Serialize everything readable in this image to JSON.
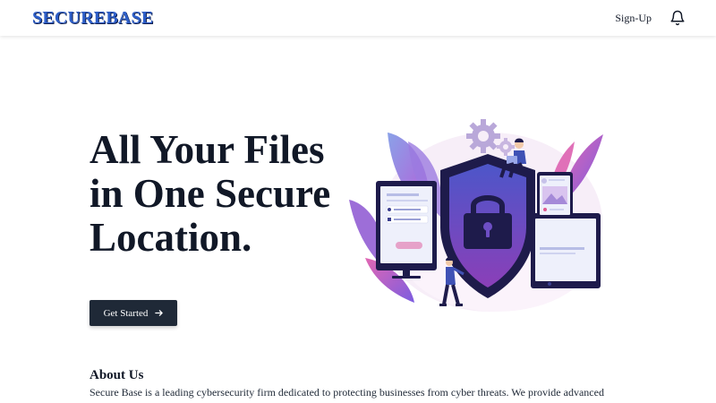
{
  "header": {
    "logo_text": "SECUREBASE",
    "signup_label": "Sign-Up",
    "notification_icon": "bell-icon"
  },
  "hero": {
    "title_lines": [
      "All Your Files",
      "in One Secure",
      "Location."
    ],
    "cta_label": "Get Started",
    "cta_icon": "arrow-right-icon",
    "illustration": "security-shield-lock-illustration"
  },
  "about": {
    "title": "About Us",
    "text": "Secure Base is a leading cybersecurity firm dedicated to protecting businesses from cyber threats. We provide advanced"
  },
  "colors": {
    "logo": "#2e5fc9",
    "button_bg": "#1f2937",
    "text": "#111827",
    "shield": "#1e1b4b",
    "accent_purple": "#7c3aed"
  }
}
